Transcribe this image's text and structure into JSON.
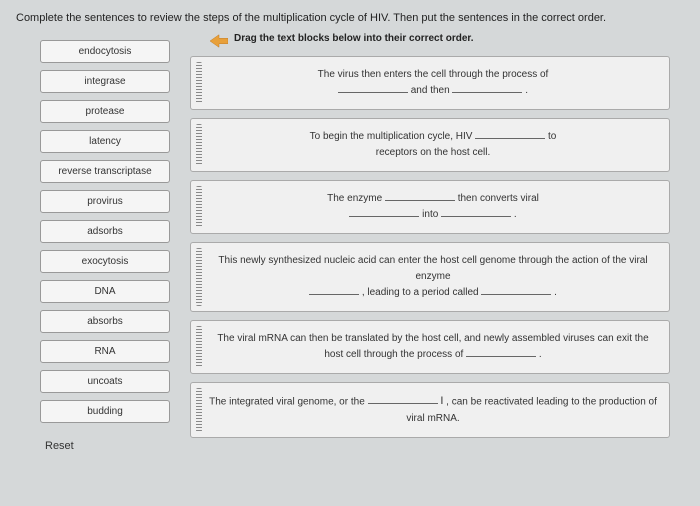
{
  "instruction": "Complete the sentences to review the steps of the multiplication cycle of HIV. Then put the sentences in the correct order.",
  "terms": [
    "endocytosis",
    "integrase",
    "protease",
    "latency",
    "reverse transcriptase",
    "provirus",
    "adsorbs",
    "exocytosis",
    "DNA",
    "absorbs",
    "RNA",
    "uncoats",
    "budding"
  ],
  "reset_label": "Reset",
  "drag_header": "Drag the text blocks below into their correct order.",
  "sentences": {
    "s1_a": "The virus then enters the cell through the process of",
    "s1_b": "and then",
    "s2_a": "To begin the multiplication cycle, HIV",
    "s2_b": "to receptors on the host cell.",
    "s3_a": "The enzyme",
    "s3_b": "then converts viral",
    "s3_c": "into",
    "s4_a": "This newly synthesized nucleic acid can enter the host cell genome through the action of the viral enzyme",
    "s4_b": ", leading to a period called",
    "s5_a": "The viral mRNA can then be translated by the host cell, and newly assembled viruses can exit the host cell through the process of",
    "s6_a": "The integrated viral genome, or the",
    "s6_b": ", can be reactivated leading to the production of viral mRNA."
  }
}
